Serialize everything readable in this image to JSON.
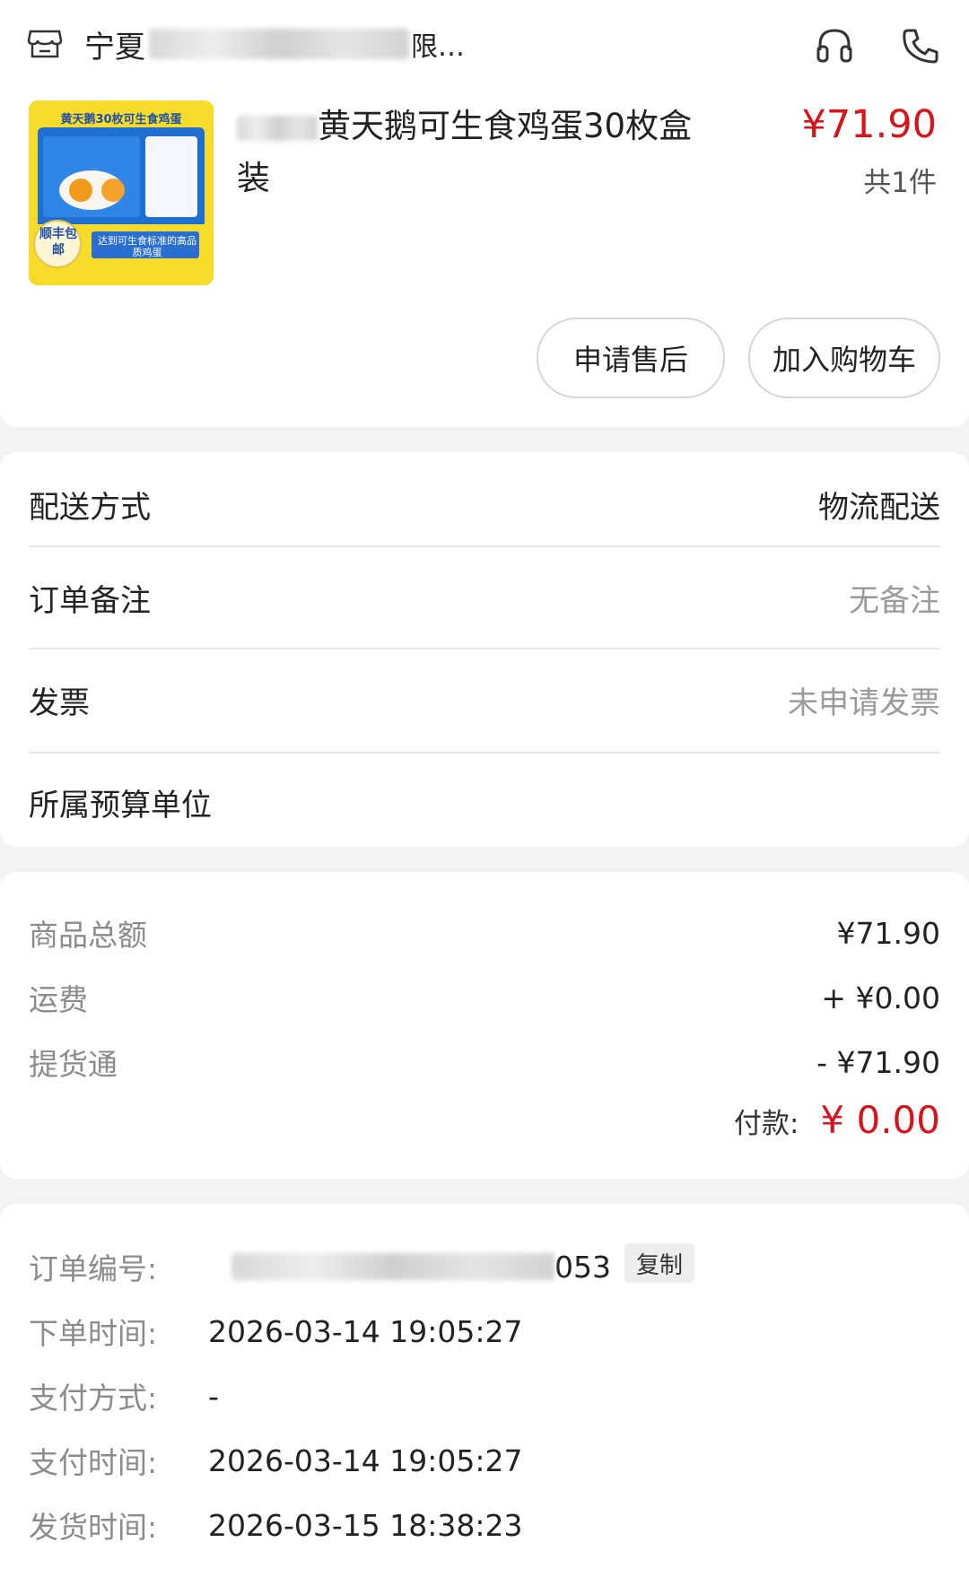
{
  "shop": {
    "name_prefix": "宁夏",
    "name_visible_end": "限…",
    "icon": "store-icon",
    "actions": [
      {
        "icon": "headset-icon"
      },
      {
        "icon": "phone-icon"
      }
    ]
  },
  "product": {
    "title": "黄天鹅可生食鸡蛋30枚盒装",
    "price": "¥71.90",
    "qty": "共1件",
    "image_caption_top": "黄天鹅30枚可生食鸡蛋",
    "image_badge": "顺丰包邮",
    "image_caption_bottom": "达到可生食标准的高品质鸡蛋"
  },
  "buttons": {
    "aftersale": "申请售后",
    "add_to_cart": "加入购物车"
  },
  "info": {
    "delivery_label": "配送方式",
    "delivery_value": "物流配送",
    "remark_label": "订单备注",
    "remark_value": "无备注",
    "invoice_label": "发票",
    "invoice_value": "未申请发票",
    "budget_label": "所属预算单位"
  },
  "price_summary": {
    "goods_label": "商品总额",
    "goods_value": "¥71.90",
    "shipping_label": "运费",
    "shipping_value": "+ ¥0.00",
    "voucher_label": "提货通",
    "voucher_value": "- ¥71.90",
    "pay_label": "付款:",
    "pay_value": "¥ 0.00"
  },
  "order": {
    "number_label": "订单编号:",
    "number_tail": "053",
    "copy_label": "复制",
    "created_label": "下单时间:",
    "created_value": "2026-03-14 19:05:27",
    "pay_method_label": "支付方式:",
    "pay_method_value": "-",
    "paid_label": "支付时间:",
    "paid_value": "2026-03-14 19:05:27",
    "shipped_label": "发货时间:",
    "shipped_value": "2026-03-15 18:38:23"
  },
  "colors": {
    "accent": "#e8453c",
    "price_red": "#d8141a",
    "muted": "#8b8b8b"
  }
}
